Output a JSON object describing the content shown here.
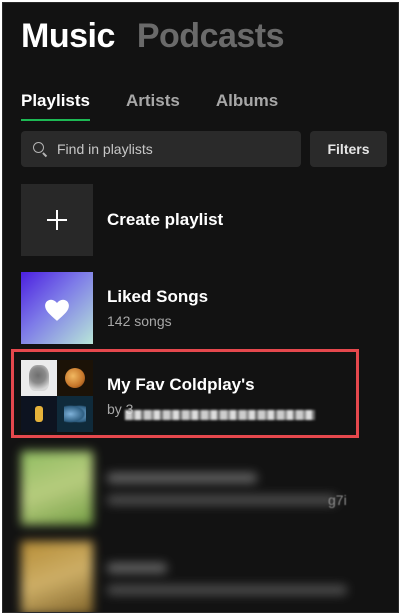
{
  "header": {
    "tabs": [
      {
        "label": "Music",
        "active": true
      },
      {
        "label": "Podcasts",
        "active": false
      }
    ]
  },
  "subtabs": [
    {
      "label": "Playlists",
      "active": true
    },
    {
      "label": "Artists",
      "active": false
    },
    {
      "label": "Albums",
      "active": false
    }
  ],
  "search": {
    "placeholder": "Find in playlists",
    "filters_label": "Filters"
  },
  "list": {
    "create": {
      "title": "Create playlist"
    },
    "liked": {
      "title": "Liked Songs",
      "subtitle": "142 songs"
    },
    "fav": {
      "title": "My Fav Coldplay's",
      "subtitle_prefix": "by 3"
    },
    "blurred_tail": "g7i"
  },
  "colors": {
    "background": "#121212",
    "accent_green": "#1db954",
    "highlight_red": "#e5484d"
  },
  "icons": [
    "search-icon",
    "plus-icon",
    "heart-icon"
  ]
}
